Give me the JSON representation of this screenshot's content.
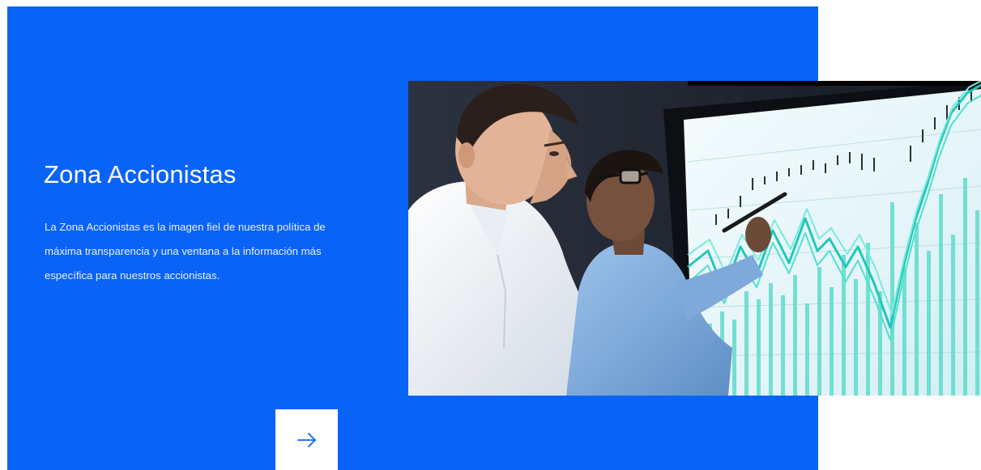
{
  "section": {
    "title": "Zona Accionistas",
    "description": "La Zona Accionistas es la imagen fiel de nuestra política de máxima transparencia y una ventana a la información más específica para nuestros accionistas."
  },
  "hero_image": {
    "subject": "two men analyzing a stock chart on a large screen"
  },
  "cta": {
    "icon": "arrow-right-icon"
  },
  "colors": {
    "panel": "#0a63f7",
    "text": "#ffffff",
    "arrow": "#0a63f7",
    "chart_line": "#2fd6c6"
  }
}
